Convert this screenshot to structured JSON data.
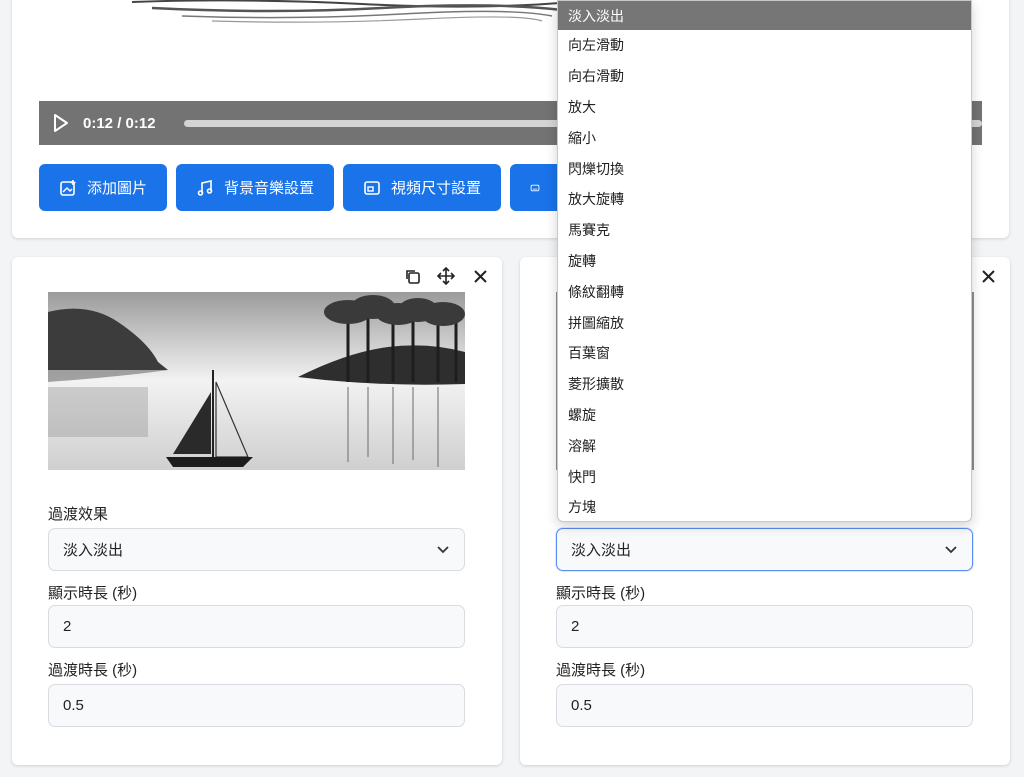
{
  "player": {
    "time": "0:12 / 0:12",
    "progress": 1.0
  },
  "toolbar": {
    "buttons": [
      {
        "label": "添加圖片",
        "icon": "image-add-icon"
      },
      {
        "label": "背景音樂設置",
        "icon": "music-note-icon"
      },
      {
        "label": "視頻尺寸設置",
        "icon": "frame-icon"
      },
      {
        "label": "",
        "icon": "keyboard-icon"
      }
    ]
  },
  "cards": [
    {
      "transition_label": "過渡效果",
      "transition_value": "淡入淡出",
      "display_label": "顯示時長 (秒)",
      "display_value": "2",
      "duration_label": "過渡時長 (秒)",
      "duration_value": "0.5"
    },
    {
      "transition_value": "淡入淡出",
      "display_label": "顯示時長 (秒)",
      "display_value": "2",
      "duration_label": "過渡時長 (秒)",
      "duration_value": "0.5"
    }
  ],
  "dropdown": {
    "selected": "淡入淡出",
    "options": [
      "淡入淡出",
      "向左滑動",
      "向右滑動",
      "放大",
      "縮小",
      "閃爍切換",
      "放大旋轉",
      "馬賽克",
      "旋轉",
      "條紋翻轉",
      "拼圖縮放",
      "百葉窗",
      "菱形擴散",
      "螺旋",
      "溶解",
      "快門",
      "方塊"
    ]
  },
  "colors": {
    "accent": "#1a73e8",
    "player_bg": "#737373",
    "selected_option_bg": "#767676"
  }
}
